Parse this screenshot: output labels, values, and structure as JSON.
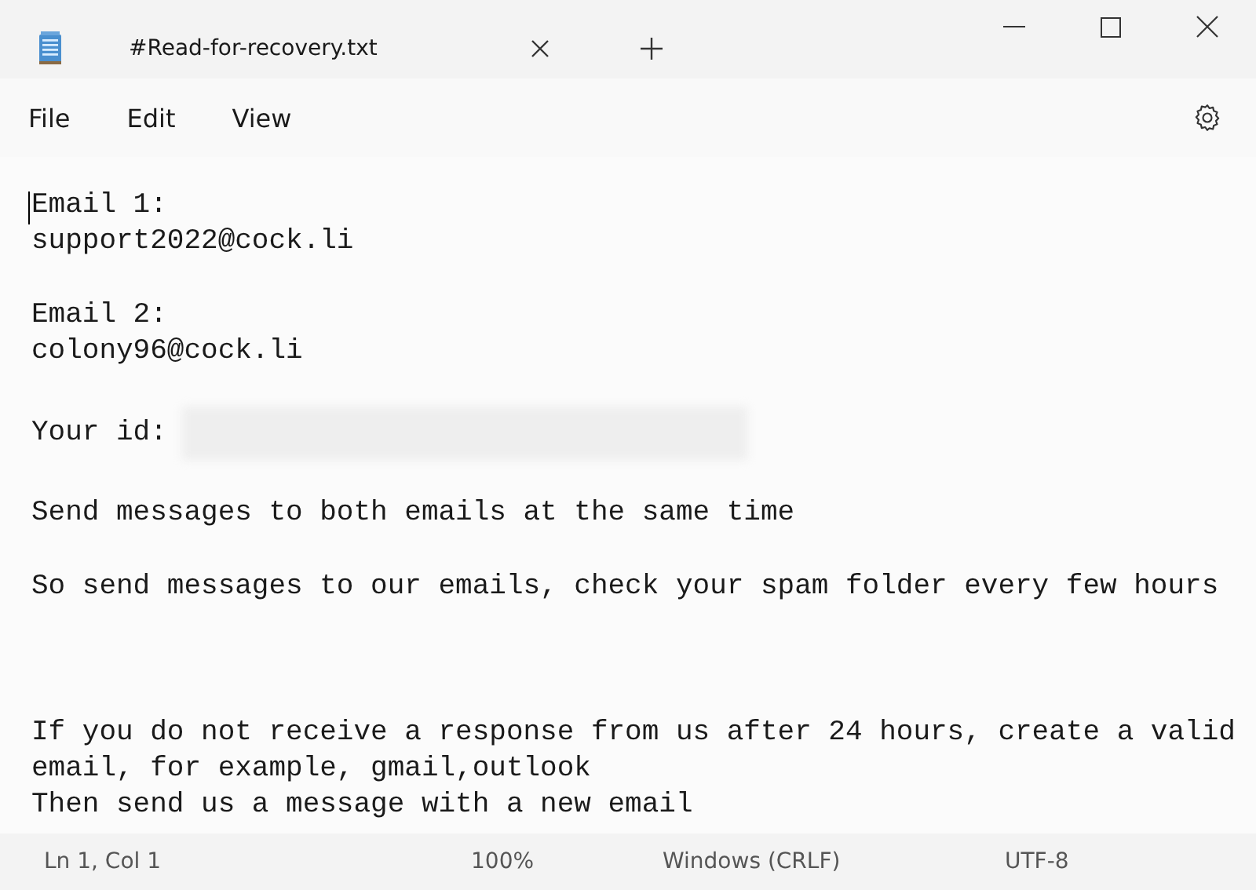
{
  "window": {
    "title": "#Read-for-recovery.txt"
  },
  "menu": [
    "File",
    "Edit",
    "View"
  ],
  "document": {
    "lines": [
      {
        "kind": "text",
        "text": "Email 1:"
      },
      {
        "kind": "text",
        "text": "support2022@cock.li"
      },
      {
        "kind": "blank"
      },
      {
        "kind": "text",
        "text": "Email 2:"
      },
      {
        "kind": "text",
        "text": "colony96@cock.li"
      },
      {
        "kind": "blank"
      },
      {
        "kind": "redacted",
        "text": "Your id:"
      },
      {
        "kind": "blank"
      },
      {
        "kind": "text",
        "text": "Send messages to both emails at the same time"
      },
      {
        "kind": "blank"
      },
      {
        "kind": "text",
        "text": "So send messages to our emails, check your spam folder every few hours"
      },
      {
        "kind": "blank"
      },
      {
        "kind": "blank"
      },
      {
        "kind": "blank"
      },
      {
        "kind": "text",
        "text": "If you do not receive a response from us after 24 hours, create a valid"
      },
      {
        "kind": "text",
        "text": "email, for example, gmail,outlook"
      },
      {
        "kind": "text",
        "text": "Then send us a message with a new email"
      }
    ]
  },
  "status_bar": {
    "position": "Ln 1, Col 1",
    "zoom": "100%",
    "line_ending": "Windows (CRLF)",
    "encoding": "UTF-8"
  }
}
